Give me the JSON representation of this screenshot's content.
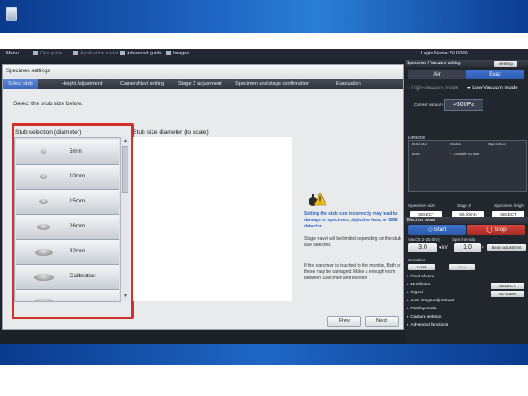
{
  "app": {
    "login_label": "Login Name:",
    "login_value": "SU5000"
  },
  "menubar": {
    "menu": "Menu",
    "ops_guide": "Ops guide",
    "application_assist": "Application assist",
    "advanced_guide": "Advanced guide",
    "images": "Images"
  },
  "dialog": {
    "title": "Specimen settings",
    "tabs": [
      "Select stub",
      "Height Adjustment",
      "CameraNavi setting",
      "Stage Z adjustment",
      "Specimen and stage confirmation",
      "Evacuation"
    ],
    "instruction": "Select the stub size below.",
    "stub_selection_header": "Stub selection (diameter)",
    "preview_header": "Stub size diameter (to scale)",
    "stubs": [
      "5mm",
      "10mm",
      "15mm",
      "26mm",
      "32mm",
      "Calibration",
      "..."
    ],
    "warning_text": "Setting the stub size incorrectly may lead to damage of specimen, objective lens, or BSE detector.",
    "info1": "Stage travel will be limited depending on the stub size selected.",
    "info2": "If the specimen is touched to the monitor, Both of these may be damaged. Make a enough room between Specimen and Monitor.",
    "prev_button": "Prev",
    "next_button": "Next"
  },
  "right_panel": {
    "vacuum_header": "Specimen / Vacuum setting",
    "venting": "Venting",
    "air": "Air",
    "evac": "Evac",
    "high_vacuum": "High-Vacuum mode",
    "low_vacuum": "Low-Vacuum mode",
    "current_vacuum_label": "Current vacuum",
    "current_vacuum_value": ">300Pa",
    "detector_header": "Detector",
    "detector_cols": [
      "Detector",
      "Status",
      "Operation"
    ],
    "detector_row": {
      "detector": "BSE",
      "status": "Unable to use"
    },
    "specimen_size_label": "Specimen size",
    "specimen_size_value": "SELECT",
    "stage_z_label": "Stage Z",
    "stage_z_value": "65.00mm",
    "specimen_height_label": "Specimen height",
    "specimen_height_value": "SELECT",
    "electron_beam_header": "Electron beam",
    "start": "Start",
    "stop": "Stop",
    "vacc_label": "Vacc(0.3~20.0kV)",
    "vacc_value": "3.0",
    "vacc_unit": "kV",
    "spot_label": "Spot intensity",
    "spot_value": "1.0",
    "beam_adjustment": "Beam adjustment",
    "condition_label": "Condition",
    "load": "Load",
    "save": "Save",
    "field_of_view": "Field of view",
    "multifinder": "Multifinder",
    "multifinder_select": "SELECT",
    "signal": "Signal",
    "signal_value": "SE-Lower",
    "auto_image": "Auto image adjustment",
    "display_mode": "Display mode",
    "capture_settings": "Capture settings",
    "advanced_functions": "Advanced functions"
  },
  "colors": {
    "highlight_box": "#d0312a",
    "accent_blue": "#3a67bf",
    "stop_red": "#d9433d"
  }
}
